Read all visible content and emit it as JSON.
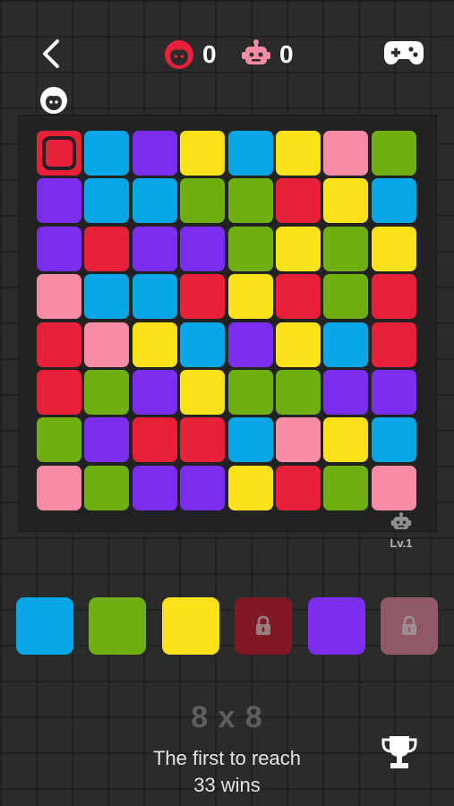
{
  "colors": {
    "red": "#e8203a",
    "blue": "#06a7e6",
    "purple": "#7b2ef0",
    "yellow": "#f9e21a",
    "pink": "#f68ca6",
    "green": "#6faf11"
  },
  "header": {
    "back_icon": "back-chevron-icon",
    "human_score": "0",
    "robot_score": "0",
    "human_icon_color": "#e8203a",
    "robot_icon_color": "#f68ca6",
    "menu_icon": "gamepad-icon",
    "turn_icon": "human-face-icon"
  },
  "board": {
    "rows": 8,
    "cols": 8,
    "cells": [
      [
        "red",
        "blue",
        "purple",
        "yellow",
        "blue",
        "yellow",
        "pink",
        "green"
      ],
      [
        "purple",
        "blue",
        "blue",
        "green",
        "green",
        "red",
        "yellow",
        "blue"
      ],
      [
        "purple",
        "red",
        "purple",
        "purple",
        "green",
        "yellow",
        "green",
        "yellow"
      ],
      [
        "pink",
        "blue",
        "blue",
        "red",
        "yellow",
        "red",
        "green",
        "red"
      ],
      [
        "red",
        "pink",
        "yellow",
        "blue",
        "purple",
        "yellow",
        "blue",
        "red"
      ],
      [
        "red",
        "green",
        "purple",
        "yellow",
        "green",
        "green",
        "purple",
        "purple"
      ],
      [
        "green",
        "purple",
        "red",
        "red",
        "blue",
        "pink",
        "yellow",
        "blue"
      ],
      [
        "pink",
        "green",
        "purple",
        "purple",
        "yellow",
        "red",
        "green",
        "pink"
      ]
    ],
    "human_start": [
      0,
      0
    ],
    "robot_level": "Lv.1"
  },
  "palette": [
    {
      "color": "blue",
      "locked": false
    },
    {
      "color": "green",
      "locked": false
    },
    {
      "color": "yellow",
      "locked": false
    },
    {
      "color": "red",
      "locked": true
    },
    {
      "color": "purple",
      "locked": false
    },
    {
      "color": "pink",
      "locked": true
    }
  ],
  "footer": {
    "board_size": "8 x 8",
    "goal_line1": "The first to reach",
    "goal_line2": "33 wins",
    "trophy_icon": "trophy-icon"
  }
}
